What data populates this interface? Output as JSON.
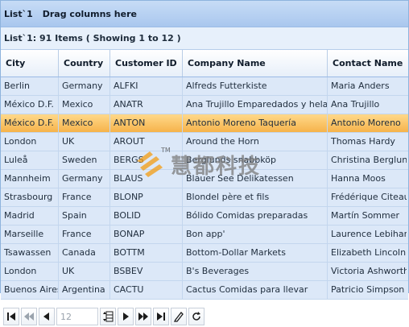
{
  "group_bar": {
    "title": "List`1",
    "hint": "Drag columns here"
  },
  "list_info": "List`1: 91 Items ( Showing 1 to 12 )",
  "columns": [
    "City",
    "Country",
    "Customer ID",
    "Company Name",
    "Contact Name"
  ],
  "rows": [
    [
      "Berlin",
      "Germany",
      "ALFKI",
      "Alfreds Futterkiste",
      "Maria Anders"
    ],
    [
      "México D.F.",
      "Mexico",
      "ANATR",
      "Ana Trujillo Emparedados y helados",
      "Ana Trujillo"
    ],
    [
      "México D.F.",
      "Mexico",
      "ANTON",
      "Antonio Moreno Taquería",
      "Antonio Moreno"
    ],
    [
      "London",
      "UK",
      "AROUT",
      "Around the Horn",
      "Thomas Hardy"
    ],
    [
      "Luleå",
      "Sweden",
      "BERGS",
      "Berglunds snabbköp",
      "Christina Berglund"
    ],
    [
      "Mannheim",
      "Germany",
      "BLAUS",
      "Blauer See Delikatessen",
      "Hanna Moos"
    ],
    [
      "Strasbourg",
      "France",
      "BLONP",
      "Blondel père et fils",
      "Frédérique Citeaux"
    ],
    [
      "Madrid",
      "Spain",
      "BOLID",
      "Bólido Comidas preparadas",
      "Martín Sommer"
    ],
    [
      "Marseille",
      "France",
      "BONAP",
      "Bon app'",
      "Laurence Lebihan"
    ],
    [
      "Tsawassen",
      "Canada",
      "BOTTM",
      "Bottom-Dollar Markets",
      "Elizabeth Lincoln"
    ],
    [
      "London",
      "UK",
      "BSBEV",
      "B's Beverages",
      "Victoria Ashworth"
    ],
    [
      "Buenos Aires",
      "Argentina",
      "CACTU",
      "Cactus Comidas para llevar",
      "Patricio Simpson"
    ]
  ],
  "selected_row_index": 2,
  "pager": {
    "page_size_value": "12",
    "buttons": [
      "first-page-icon",
      "previous-group-icon",
      "previous-page-icon",
      "page-size-icon",
      "next-page-icon",
      "next-group-icon",
      "last-page-icon",
      "edit-pencil-icon",
      "refresh-icon"
    ]
  },
  "watermark": {
    "tm": "TM",
    "text": "慧都科技"
  },
  "colors": {
    "selected_row": "#f6b34b",
    "header_accent": "#a9c7ee",
    "row_bg": "#dce8f8"
  }
}
